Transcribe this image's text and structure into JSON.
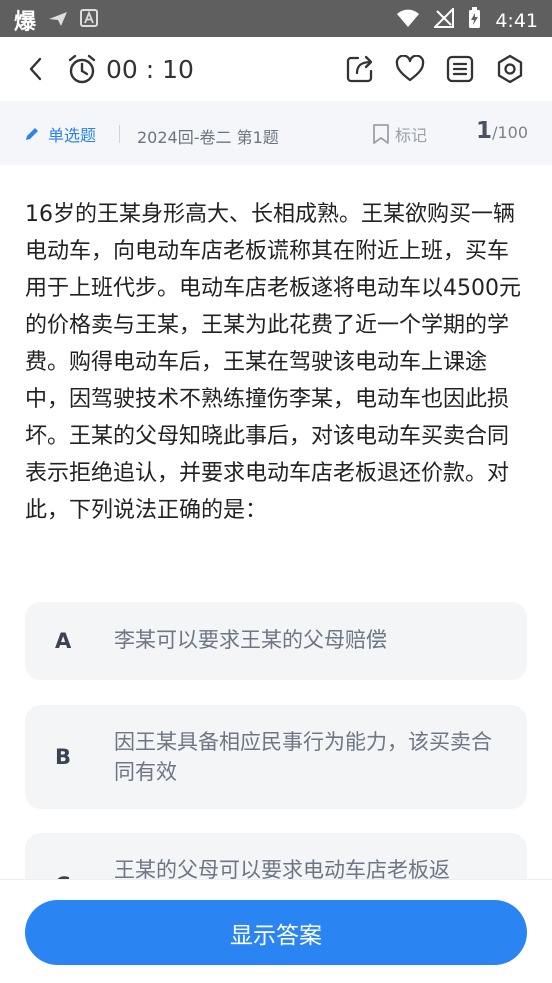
{
  "status": {
    "app_char": "爆",
    "time": "4:41"
  },
  "timer": {
    "value": "00 : 10"
  },
  "info": {
    "type_label": "单选题",
    "source": "2024回-卷二 第1题",
    "mark_label": "标记",
    "progress_current": "1",
    "progress_total": "/100"
  },
  "question": {
    "text": "16岁的王某身形高大、长相成熟。王某欲购买一辆电动车，向电动车店老板谎称其在附近上班，买车用于上班代步。电动车店老板遂将电动车以4500元的价格卖与王某，王某为此花费了近一个学期的学费。购得电动车后，王某在驾驶该电动车上课途中，因驾驶技术不熟练撞伤李某，电动车也因此损坏。王某的父母知晓此事后，对该电动车买卖合同表示拒绝追认，并要求电动车店老板退还价款。对此，下列说法正确的是："
  },
  "options": [
    {
      "letter": "A",
      "text": "李某可以要求王某的父母赔偿"
    },
    {
      "letter": "B",
      "text": "因王某具备相应民事行为能力，该买卖合同有效"
    },
    {
      "letter": "C",
      "text": "王某的父母可以要求电动车店老板返"
    }
  ],
  "actions": {
    "show_answer": "显示答案"
  },
  "colors": {
    "accent": "#2a85f2",
    "status_bar": "#5f5f5f",
    "option_bg": "#f4f5f7"
  }
}
